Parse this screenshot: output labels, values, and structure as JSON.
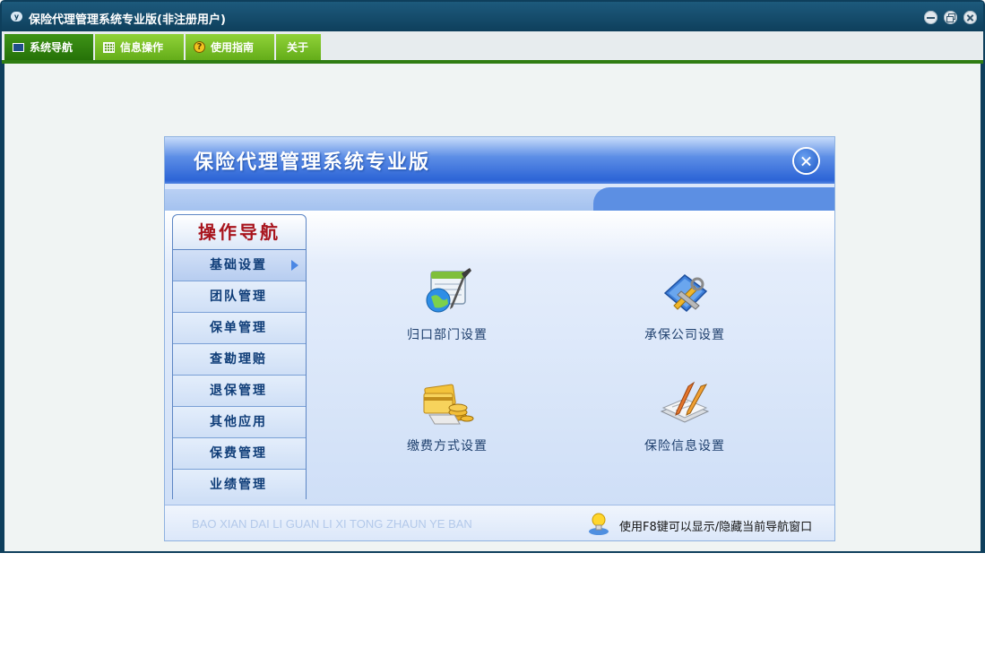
{
  "window": {
    "title": "保险代理管理系统专业版(非注册用户)",
    "app_icon_text": "y"
  },
  "menubar": {
    "tabs": [
      {
        "label": "系统导航",
        "icon": "monitor-icon",
        "active": true
      },
      {
        "label": "信息操作",
        "icon": "grid-icon",
        "active": false
      },
      {
        "label": "使用指南",
        "icon": "help-icon",
        "active": false
      },
      {
        "label": "关于",
        "icon": "",
        "active": false
      }
    ],
    "help_icon_glyph": "?"
  },
  "panel": {
    "title": "保险代理管理系统专业版",
    "nav": {
      "header": "操作导航",
      "items": [
        "基础设置",
        "团队管理",
        "保单管理",
        "查勘理赔",
        "退保管理",
        "其他应用",
        "保费管理",
        "业绩管理"
      ],
      "active_index": 0
    },
    "tiles": [
      {
        "label": "归口部门设置",
        "icon": "calendar-globe-icon"
      },
      {
        "label": "承保公司设置",
        "icon": "tools-icon"
      },
      {
        "label": "缴费方式设置",
        "icon": "cards-coins-icon"
      },
      {
        "label": "保险信息设置",
        "icon": "document-pen-icon"
      }
    ],
    "footer": {
      "pinyin": "BAO XIAN DAI LI GUAN LI XI TONG ZHAUN YE BAN",
      "tip": "使用F8键可以显示/隐藏当前导航窗口"
    }
  },
  "colors": {
    "title_bar": "#0e3f5c",
    "tab_green": "#64ad19",
    "tab_active": "#267208",
    "nav_header_text": "#a8141d",
    "panel_blue": "#2c64d6"
  }
}
